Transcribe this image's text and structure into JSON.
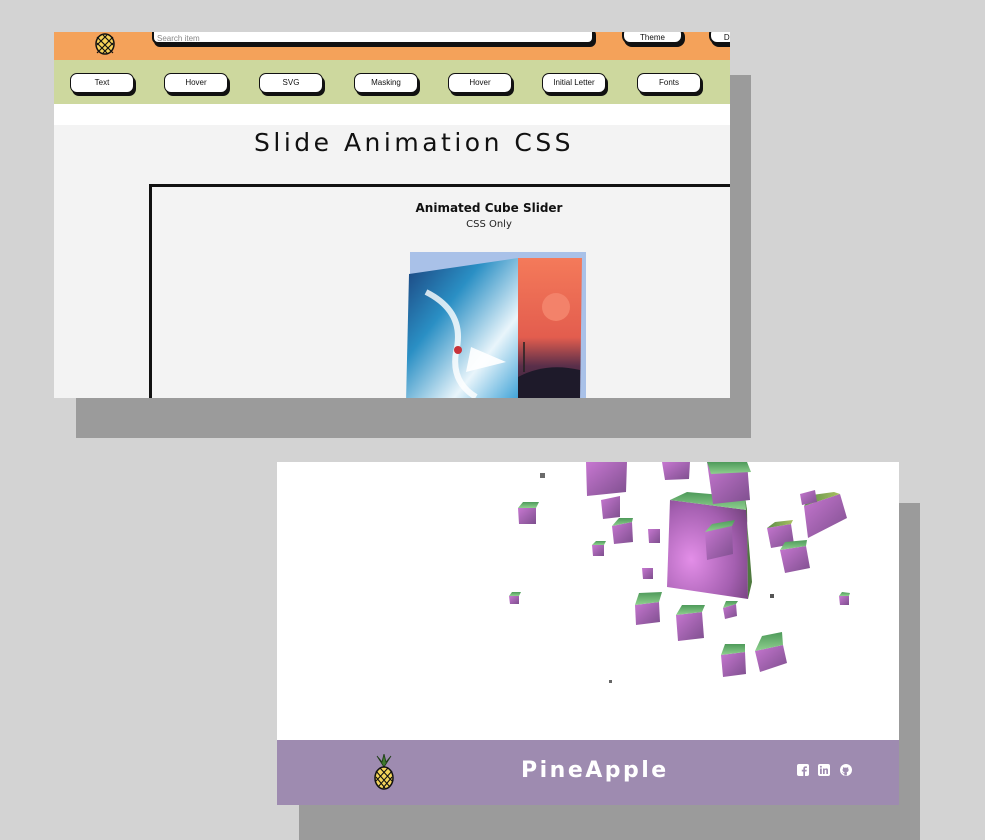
{
  "top_page": {
    "search_placeholder": "Search item",
    "header_buttons": [
      "Theme",
      "Da"
    ],
    "nav_buttons": [
      "Text",
      "Hover",
      "SVG",
      "Masking",
      "Hover",
      "Initial Letter",
      "Fonts"
    ],
    "page_title": "Slide Animation CSS",
    "card": {
      "title": "Animated Cube Slider",
      "subtitle": "CSS Only"
    },
    "colors": {
      "header_bg": "#f4a25a",
      "nav_bg": "#cdd89e",
      "page_bg": "#f3f3f3"
    },
    "icons": [
      "pineapple-logo-icon"
    ]
  },
  "bottom_page": {
    "brand": "PineApple",
    "social_icons": [
      "facebook-icon",
      "linkedin-icon",
      "github-icon"
    ],
    "colors": {
      "footer_bg": "#9e8bb0",
      "cube_top": "#6fbf6f",
      "cube_side": "#a85fb0"
    },
    "icons": [
      "pineapple-logo-icon"
    ]
  }
}
